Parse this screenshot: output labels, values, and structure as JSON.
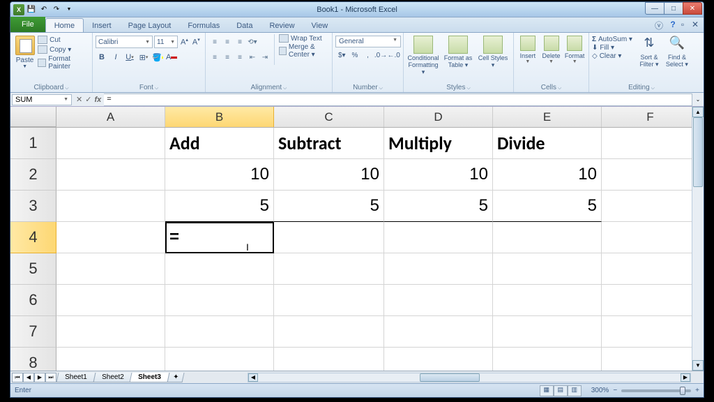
{
  "title": "Book1 - Microsoft Excel",
  "qat": {
    "save": "save",
    "undo": "undo",
    "redo": "redo"
  },
  "tabs": {
    "file": "File",
    "home": "Home",
    "insert": "Insert",
    "pageLayout": "Page Layout",
    "formulas": "Formulas",
    "data": "Data",
    "review": "Review",
    "view": "View"
  },
  "ribbon": {
    "clipboard": {
      "label": "Clipboard",
      "paste": "Paste",
      "cut": "Cut",
      "copy": "Copy ▾",
      "painter": "Format Painter"
    },
    "font": {
      "label": "Font",
      "name": "Calibri",
      "size": "11"
    },
    "alignment": {
      "label": "Alignment",
      "wrap": "Wrap Text",
      "merge": "Merge & Center ▾"
    },
    "number": {
      "label": "Number",
      "format": "General"
    },
    "styles": {
      "label": "Styles",
      "cond": "Conditional Formatting ▾",
      "table": "Format as Table ▾",
      "cell": "Cell Styles ▾"
    },
    "cells": {
      "label": "Cells",
      "insert": "Insert",
      "delete": "Delete",
      "format": "Format"
    },
    "editing": {
      "label": "Editing",
      "autosum": "AutoSum ▾",
      "fill": "Fill ▾",
      "clear": "Clear ▾",
      "sort": "Sort & Filter ▾",
      "find": "Find & Select ▾"
    }
  },
  "namebox": "SUM",
  "formula": "=",
  "columns": [
    "A",
    "B",
    "C",
    "D",
    "E",
    "F"
  ],
  "rowcount": 8,
  "sheet": {
    "B1": "Add",
    "C1": "Subtract",
    "D1": "Multiply",
    "E1": "Divide",
    "B2": "10",
    "C2": "10",
    "D2": "10",
    "E2": "10",
    "B3": "5",
    "C3": "5",
    "D3": "5",
    "E3": "5",
    "B4": "="
  },
  "activeCell": "B4",
  "sheetTabs": [
    "Sheet1",
    "Sheet2",
    "Sheet3"
  ],
  "activeSheet": "Sheet3",
  "status": {
    "mode": "Enter",
    "zoom": "300%"
  }
}
